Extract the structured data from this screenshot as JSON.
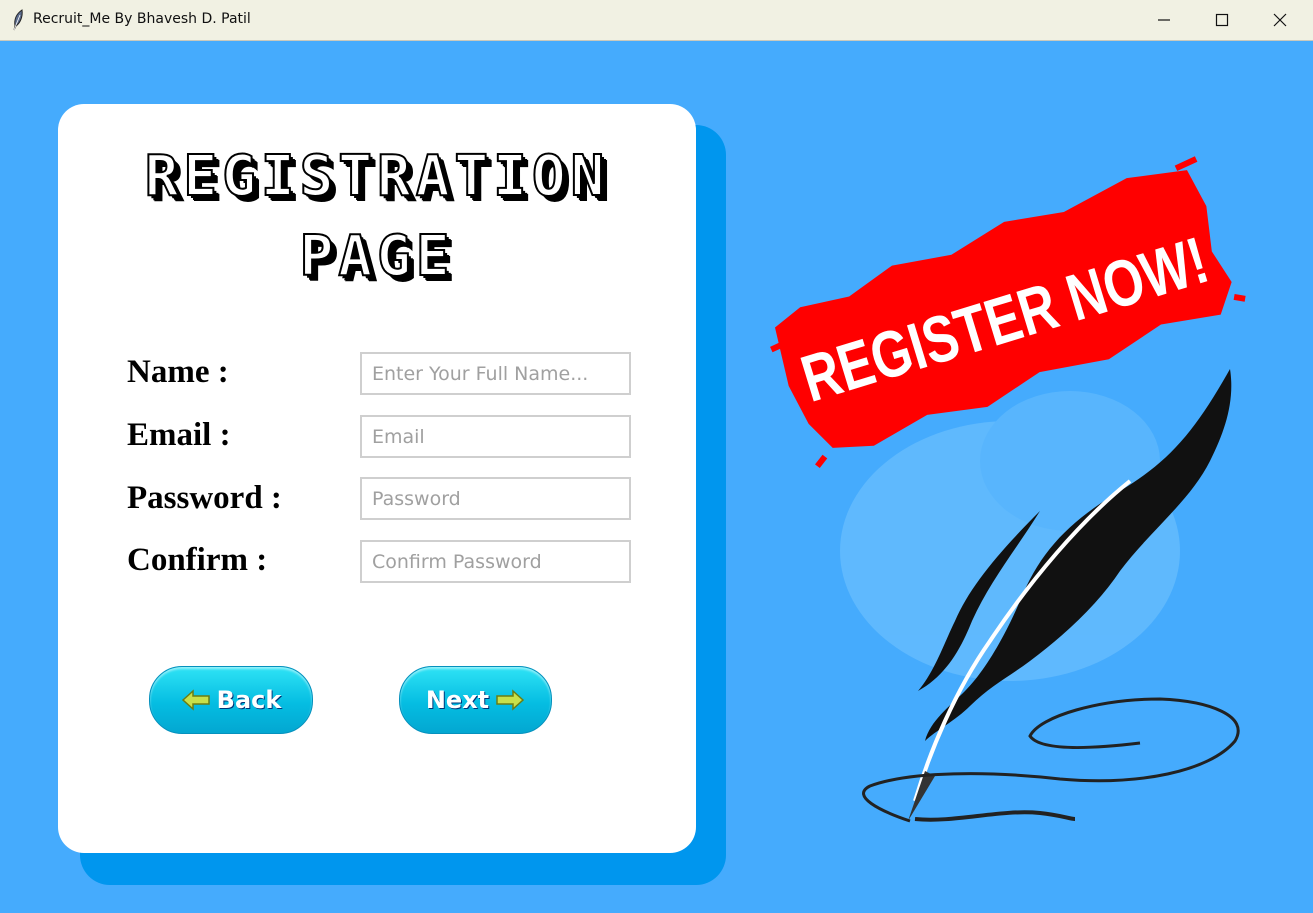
{
  "window": {
    "title": "Recruit_Me By Bhavesh D. Patil",
    "icon": "feather-icon",
    "controls": [
      "minimize",
      "maximize",
      "close"
    ]
  },
  "form": {
    "heading_line1": "REGISTRATION",
    "heading_line2": "PAGE",
    "fields": [
      {
        "label": "Name :",
        "placeholder": "Enter Your Full Name...",
        "value": ""
      },
      {
        "label": "Email :",
        "placeholder": "Email",
        "value": ""
      },
      {
        "label": "Password :",
        "placeholder": "Password",
        "value": ""
      },
      {
        "label": "Confirm :",
        "placeholder": "Confirm Password",
        "value": ""
      }
    ],
    "back_label": "Back",
    "next_label": "Next"
  },
  "promo": {
    "banner_text": "REGISTER NOW!",
    "illustration": "quill-pen-icon"
  },
  "colors": {
    "background": "#45abfd",
    "card": "#ffffff",
    "card_shadow": "#0096ee",
    "button": "#05bde2",
    "banner": "#ff0000"
  }
}
